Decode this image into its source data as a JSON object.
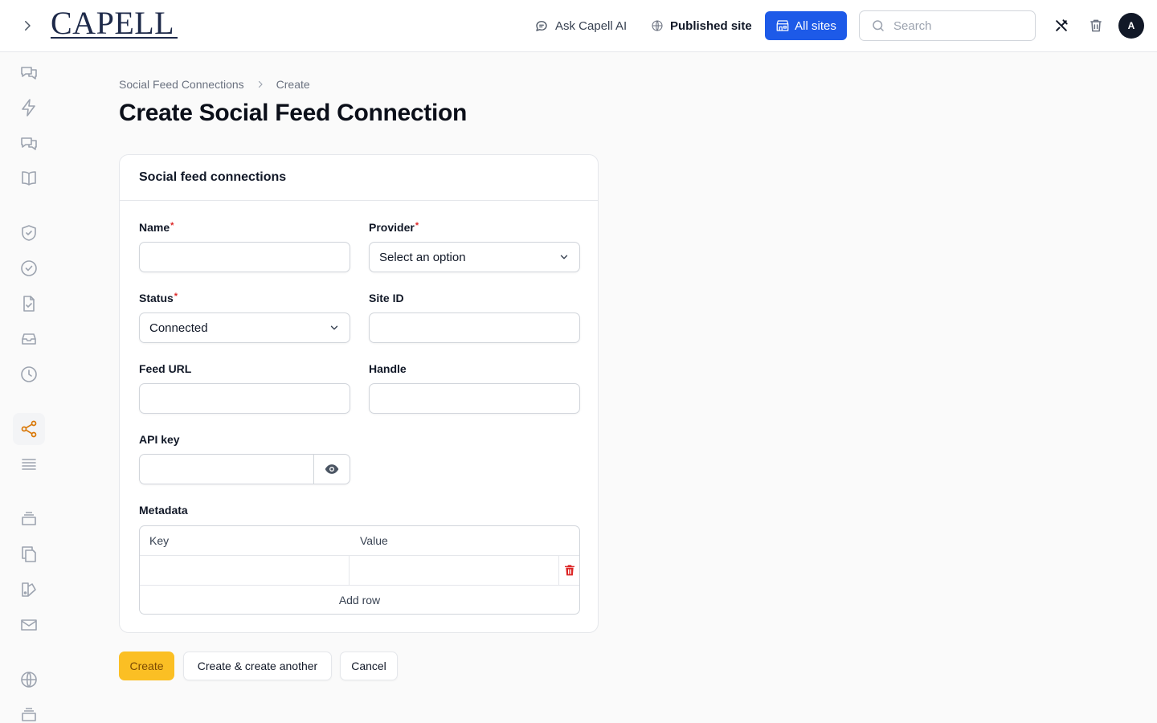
{
  "header": {
    "logo_text": "CAPELL",
    "ask_ai_label": "Ask Capell AI",
    "published_site_label": "Published site",
    "all_sites_label": "All sites",
    "search_placeholder": "Search",
    "avatar_initial": "A"
  },
  "sidebar": {
    "items": [
      {
        "icon": "chat-bubbles-icon"
      },
      {
        "icon": "bolt-icon"
      },
      {
        "icon": "chat-bubbles-icon"
      },
      {
        "icon": "book-icon"
      },
      {
        "icon": "shield-check-icon"
      },
      {
        "icon": "check-circle-icon"
      },
      {
        "icon": "document-check-icon"
      },
      {
        "icon": "inbox-stack-icon"
      },
      {
        "icon": "clock-icon"
      },
      {
        "icon": "share-icon",
        "active": true
      },
      {
        "icon": "list-icon"
      },
      {
        "icon": "rectangle-stack-icon"
      },
      {
        "icon": "documents-icon"
      },
      {
        "icon": "swatch-icon"
      },
      {
        "icon": "envelope-icon"
      },
      {
        "icon": "globe-icon"
      },
      {
        "icon": "rectangle-stack-icon"
      }
    ],
    "active_color": "#d97706"
  },
  "breadcrumb": {
    "parent": "Social Feed Connections",
    "current": "Create"
  },
  "page_title": "Create Social Feed Connection",
  "form": {
    "section_title": "Social feed connections",
    "name": {
      "label": "Name",
      "required": "*",
      "value": ""
    },
    "provider": {
      "label": "Provider",
      "required": "*",
      "value": "Select an option"
    },
    "status": {
      "label": "Status",
      "required": "*",
      "value": "Connected"
    },
    "site_id": {
      "label": "Site ID",
      "value": ""
    },
    "feed_url": {
      "label": "Feed URL",
      "value": ""
    },
    "handle": {
      "label": "Handle",
      "value": ""
    },
    "api_key": {
      "label": "API key",
      "value": ""
    },
    "metadata": {
      "label": "Metadata",
      "key_header": "Key",
      "value_header": "Value",
      "rows": [
        {
          "key": "",
          "value": ""
        }
      ],
      "add_row_label": "Add row"
    }
  },
  "actions": {
    "create_label": "Create",
    "create_another_label": "Create & create another",
    "cancel_label": "Cancel"
  },
  "colors": {
    "brand_blue": "#1d5ae8",
    "primary_button": "#fbbf24",
    "danger": "#dc2626"
  }
}
